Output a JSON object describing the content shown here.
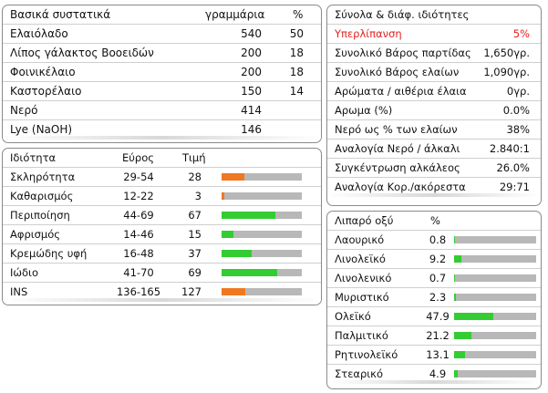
{
  "ingredients": {
    "header": {
      "name": "Βασικά συστατικά",
      "grams": "γραμμάρια",
      "pct": "%"
    },
    "rows": [
      {
        "name": "Ελαιόλαδο",
        "grams": "540",
        "pct": "50"
      },
      {
        "name": "Λίπος γάλακτος Βοοειδών",
        "grams": "200",
        "pct": "18"
      },
      {
        "name": "Φοινικέλαιο",
        "grams": "200",
        "pct": "18"
      },
      {
        "name": "Καστορέλαιο",
        "grams": "150",
        "pct": "14"
      },
      {
        "name": "Νερό",
        "grams": "414",
        "pct": ""
      },
      {
        "name": "Lye (NaOH)",
        "grams": "146",
        "pct": ""
      }
    ]
  },
  "properties": {
    "header": {
      "name": "Ιδιότητα",
      "range": "Εύρος",
      "value": "Τιμή"
    },
    "rows": [
      {
        "name": "Σκληρότητα",
        "range": "29-54",
        "value": "28",
        "fraction": 0.28,
        "color": "#f07820"
      },
      {
        "name": "Καθαρισμός",
        "range": "12-22",
        "value": "3",
        "fraction": 0.03,
        "color": "#f07820"
      },
      {
        "name": "Περιποίηση",
        "range": "44-69",
        "value": "67",
        "fraction": 0.67,
        "color": "#33cc33"
      },
      {
        "name": "Αφρισμός",
        "range": "14-46",
        "value": "15",
        "fraction": 0.15,
        "color": "#33cc33"
      },
      {
        "name": "Κρεμώδης υφή",
        "range": "16-48",
        "value": "37",
        "fraction": 0.37,
        "color": "#33cc33"
      },
      {
        "name": "Ιώδιο",
        "range": "41-70",
        "value": "69",
        "fraction": 0.69,
        "color": "#33cc33"
      },
      {
        "name": "INS",
        "range": "136-165",
        "value": "127",
        "fraction": 0.3,
        "color": "#f07820"
      }
    ]
  },
  "totals": {
    "header": "Σύνολα & διάφ. ιδιότητες",
    "rows": [
      {
        "label": "Υπερλίπανση",
        "value": "5%",
        "warn": true
      },
      {
        "label": "Συνολικό Βάρος παρτίδας",
        "value": "1,650γρ."
      },
      {
        "label": "Συνολικό Βάρος ελαίων",
        "value": "1,090γρ."
      },
      {
        "label": "Αρώματα / αιθέρια έλαια",
        "value": "0γρ."
      },
      {
        "label": "Αρωμα (%)",
        "value": "0.0%"
      },
      {
        "label": "Νερό ως % των ελαίων",
        "value": "38%"
      },
      {
        "label": "Αναλογία Νερό / άλκαλι",
        "value": "2.840:1"
      },
      {
        "label": "Συγκέντρωση αλκάλεος",
        "value": "26.0%"
      },
      {
        "label": "Αναλογία Κορ./ακόρεστα",
        "value": "29:71"
      }
    ]
  },
  "fatty_acids": {
    "header": {
      "name": "Λιπαρό οξύ",
      "pct": "%"
    },
    "bar_color": "#33cc33",
    "rows": [
      {
        "name": "Λαουρικό",
        "value": "0.8",
        "fraction": 0.008
      },
      {
        "name": "Λινολεϊκό",
        "value": "9.2",
        "fraction": 0.092
      },
      {
        "name": "Λινολενικό",
        "value": "0.7",
        "fraction": 0.007
      },
      {
        "name": "Μυριστικό",
        "value": "2.3",
        "fraction": 0.023
      },
      {
        "name": "Ολεϊκό",
        "value": "47.9",
        "fraction": 0.479
      },
      {
        "name": "Παλμιτικό",
        "value": "21.2",
        "fraction": 0.212
      },
      {
        "name": "Ρητινολεϊκό",
        "value": "13.1",
        "fraction": 0.131
      },
      {
        "name": "Στεαρικό",
        "value": "4.9",
        "fraction": 0.049
      }
    ]
  }
}
